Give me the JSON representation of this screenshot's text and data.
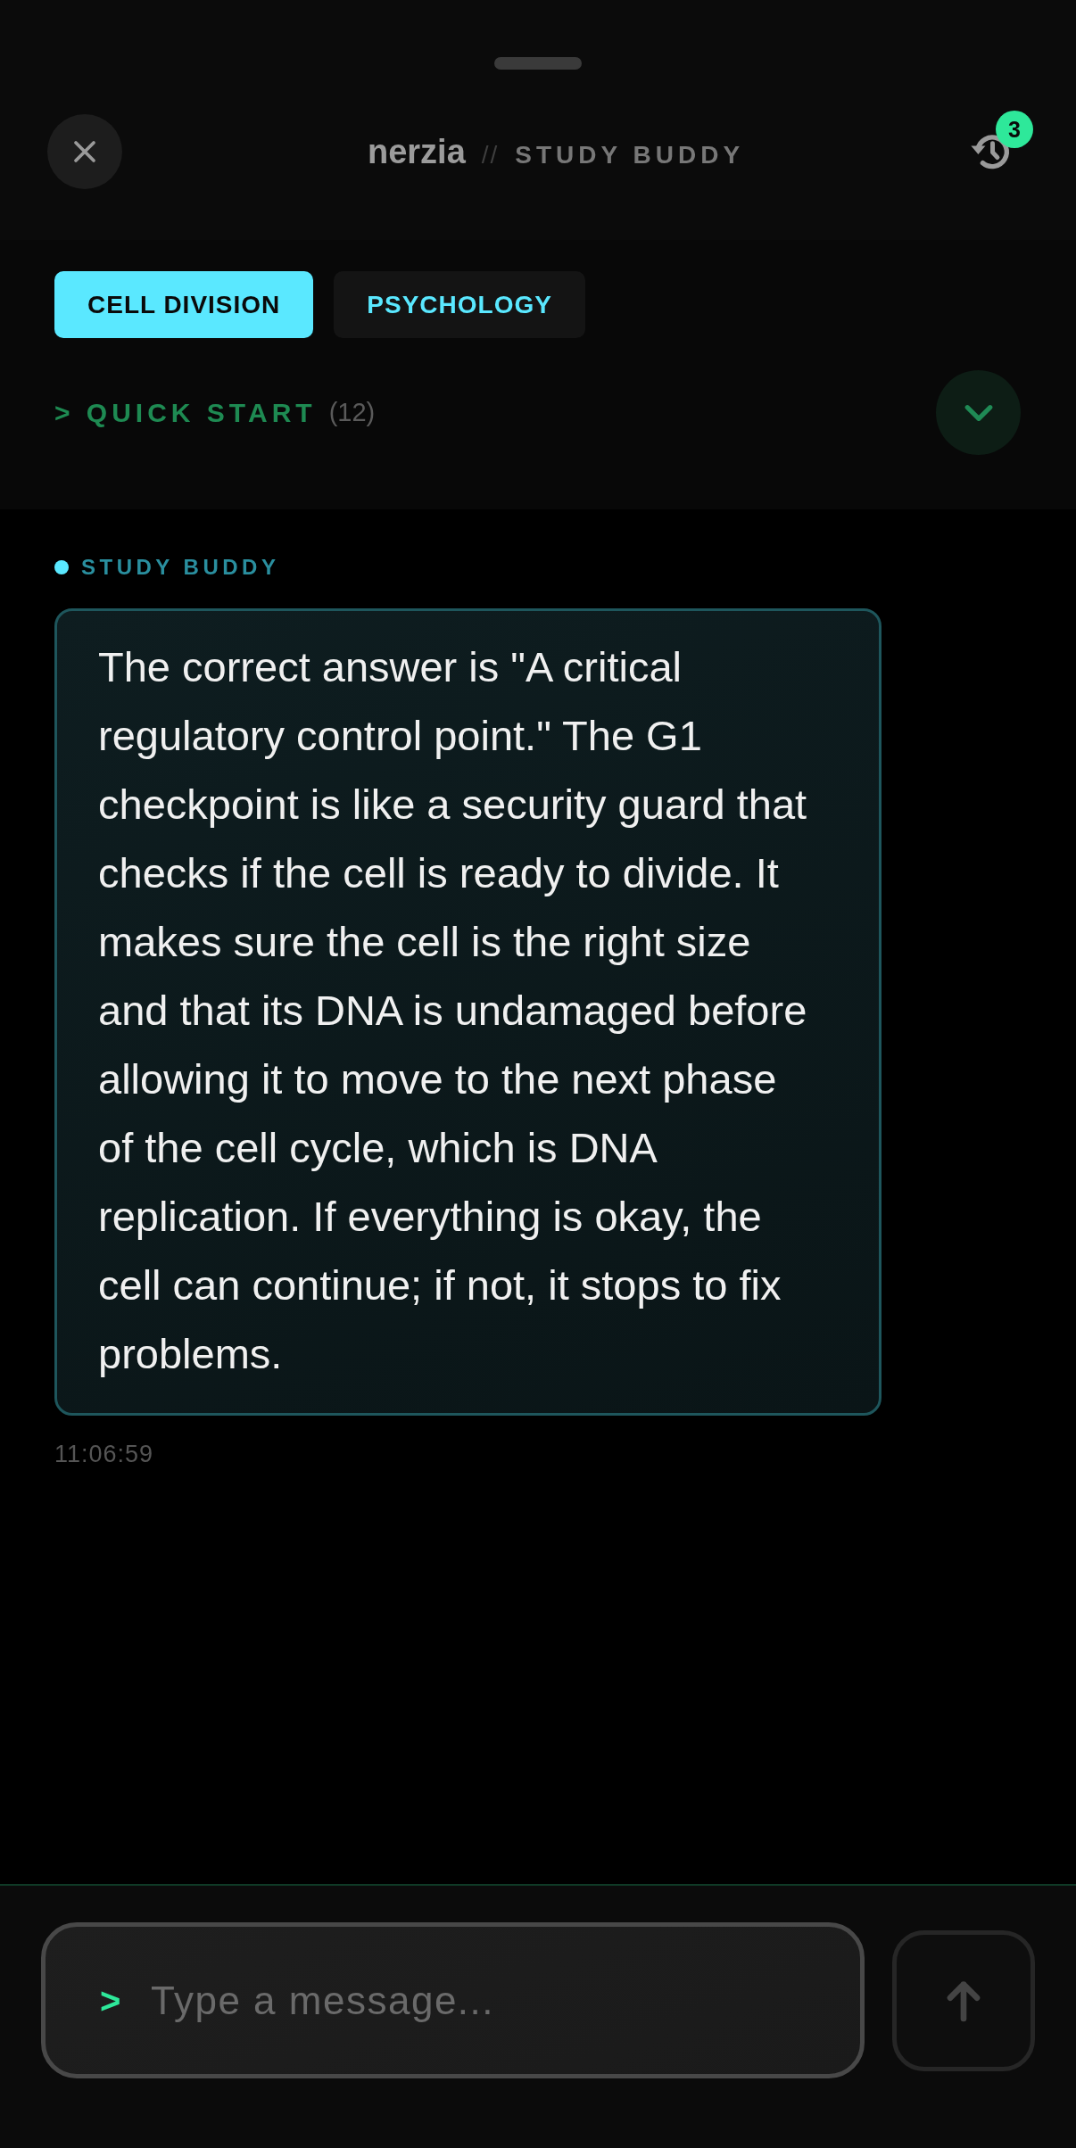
{
  "header": {
    "brand": "nerzia",
    "separator": "//",
    "title": "STUDY BUDDY",
    "history_badge": "3"
  },
  "topics": [
    {
      "label": "CELL DIVISION",
      "selected": true
    },
    {
      "label": "PSYCHOLOGY",
      "selected": false
    }
  ],
  "quick_start": {
    "label": "> QUICK START",
    "count": "(12)",
    "expanded": false
  },
  "messages": [
    {
      "sender": "STUDY BUDDY",
      "text": "The correct answer is \"A critical regulatory control point.\" The G1 checkpoint is like a security guard that checks if the cell is ready to divide. It makes sure the cell is the right size and that its DNA is undamaged before allowing it to move to the next phase of the cell cycle, which is DNA replication. If everything is okay, the cell can continue; if not, it stops to fix problems.",
      "time": "11:06:59"
    }
  ],
  "composer": {
    "prompt": ">",
    "placeholder": "Type a message..."
  }
}
